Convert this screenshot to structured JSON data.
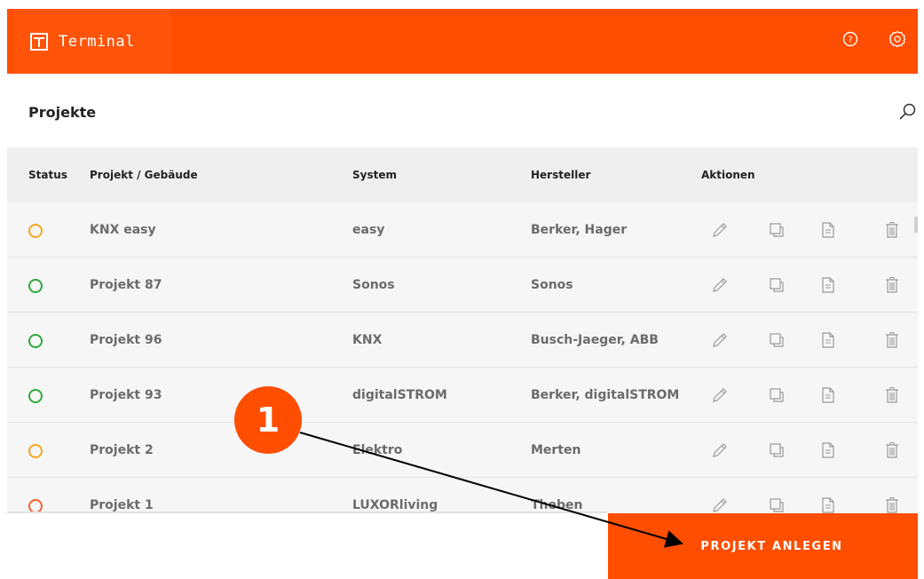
{
  "colors": {
    "accent": "#ff4e00",
    "status_pending": "#f5a623",
    "status_ok": "#2eaa3c",
    "status_error": "#f0642d",
    "icon_gray": "#9a9a9a"
  },
  "app": {
    "title": "Terminal",
    "logo_icon": "t-bracket-logo-icon"
  },
  "header": {
    "help_icon": "help-circle-icon",
    "settings_icon": "gear-icon"
  },
  "section": {
    "title": "Projekte",
    "search_icon": "search-icon"
  },
  "table": {
    "columns": [
      "Status",
      "Projekt / Gebäude",
      "System",
      "Hersteller",
      "Aktionen"
    ],
    "action_icons": [
      "pencil-icon",
      "duplicate-icon",
      "document-icon",
      "trash-icon"
    ],
    "rows": [
      {
        "status": "pending",
        "project": "KNX easy",
        "system": "easy",
        "manufacturer": "Berker, Hager"
      },
      {
        "status": "ok",
        "project": "Projekt 87",
        "system": "Sonos",
        "manufacturer": "Sonos"
      },
      {
        "status": "ok",
        "project": "Projekt 96",
        "system": "KNX",
        "manufacturer": "Busch-Jaeger, ABB"
      },
      {
        "status": "ok",
        "project": "Projekt 93",
        "system": "digitalSTROM",
        "manufacturer": "Berker, digitalSTROM"
      },
      {
        "status": "pending",
        "project": "Projekt 2",
        "system": "Elektro",
        "manufacturer": "Merten"
      },
      {
        "status": "error",
        "project": "Projekt 1",
        "system": "LUXORliving",
        "manufacturer": "Theben"
      }
    ]
  },
  "cta": {
    "label": "PROJEKT ANLEGEN"
  },
  "annotation": {
    "number": "1"
  }
}
